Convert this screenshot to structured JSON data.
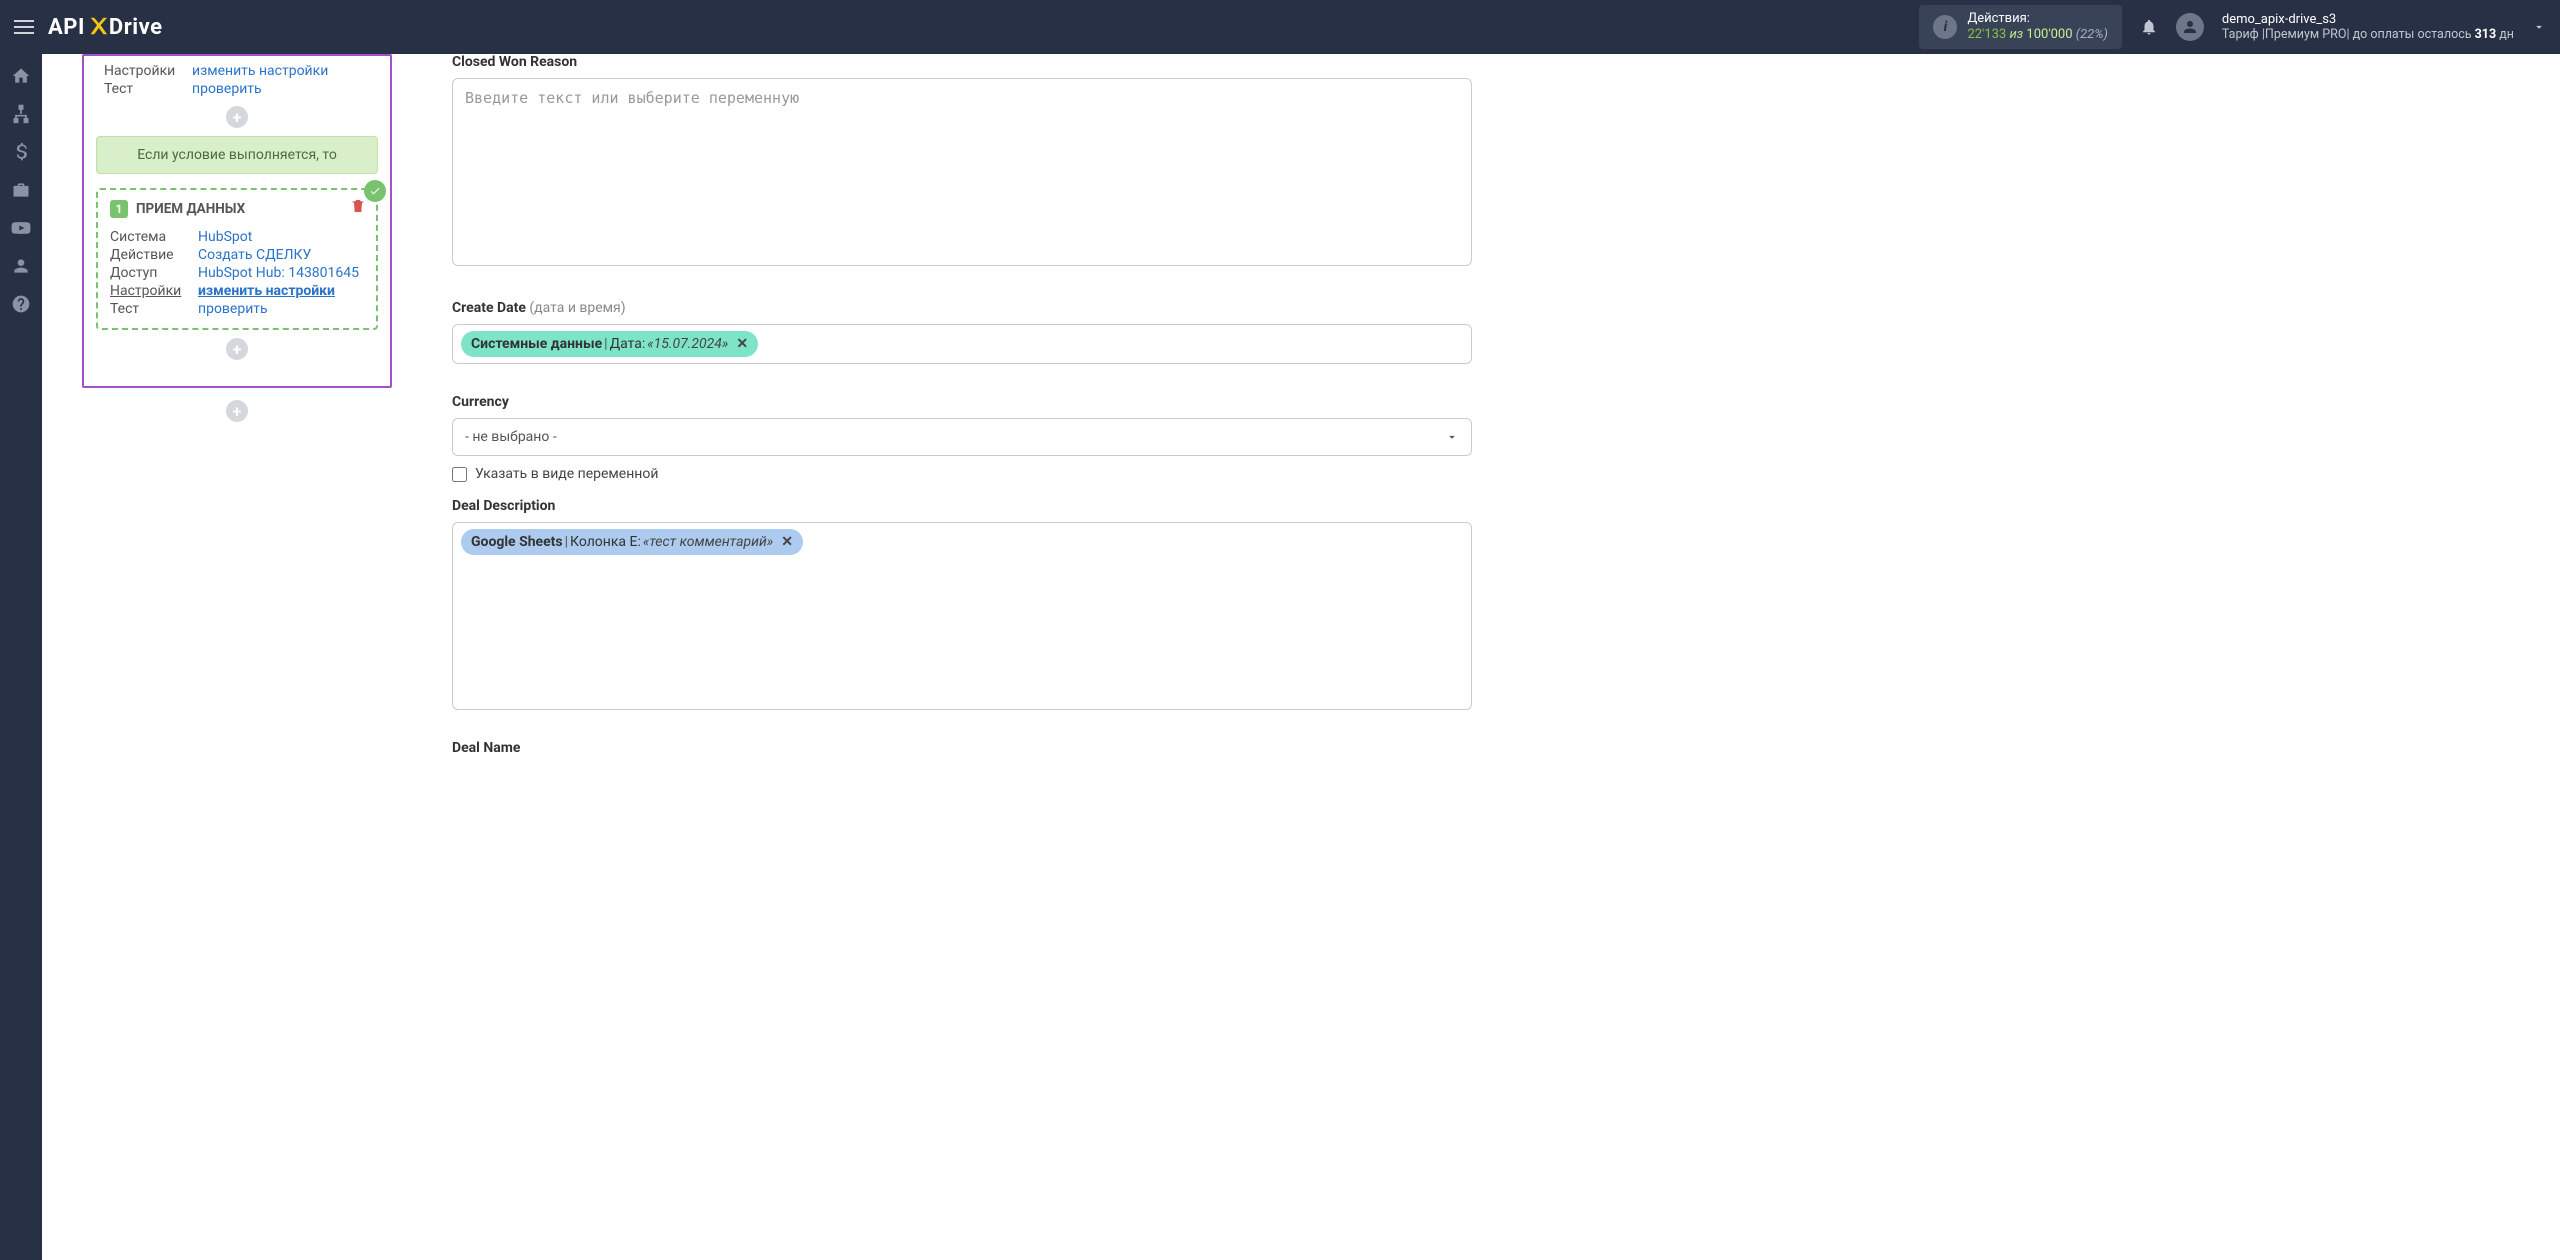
{
  "header": {
    "logo_api": "API",
    "logo_drive": "Drive",
    "actions_label": "Действия:",
    "actions_used": "22'133",
    "actions_sep": "из",
    "actions_total": "100'000",
    "actions_pct": "(22%)",
    "user_name": "demo_apix-drive_s3",
    "plan_prefix": "Тариф |",
    "plan_name": "Премиум PRO",
    "plan_mid": "| до оплаты осталось ",
    "plan_days": "313",
    "plan_unit": " дн"
  },
  "left": {
    "top_rows": {
      "settings_lbl": "Настройки",
      "settings_lnk": "изменить настройки",
      "test_lbl": "Тест",
      "test_lnk": "проверить"
    },
    "cond_text": "Если условие выполняется, то",
    "step": {
      "num": "1",
      "title": "ПРИЕМ ДАННЫХ",
      "rows": {
        "system_lbl": "Система",
        "system_val": "HubSpot",
        "action_lbl": "Действие",
        "action_val": "Создать СДЕЛКУ",
        "access_lbl": "Доступ",
        "access_val": "HubSpot Hub: 143801645",
        "settings_lbl": "Настройки",
        "settings_val": "изменить настройки",
        "test_lbl": "Тест",
        "test_val": "проверить"
      }
    }
  },
  "form": {
    "closed_won_label": "Closed Won Reason",
    "closed_won_ph": "Введите текст или выберите переменную",
    "create_date_label": "Create Date",
    "create_date_sub": "(дата и время)",
    "create_chip_src": "Системные данные",
    "create_chip_key": "Дата:",
    "create_chip_val": "«15.07.2024»",
    "currency_label": "Currency",
    "currency_placeholder": "- не выбрано -",
    "var_checkbox": "Указать в виде переменной",
    "desc_label": "Deal Description",
    "desc_chip_src": "Google Sheets",
    "desc_chip_key": "Колонка E:",
    "desc_chip_val": "«тест комментарий»",
    "dealname_label": "Deal Name"
  }
}
